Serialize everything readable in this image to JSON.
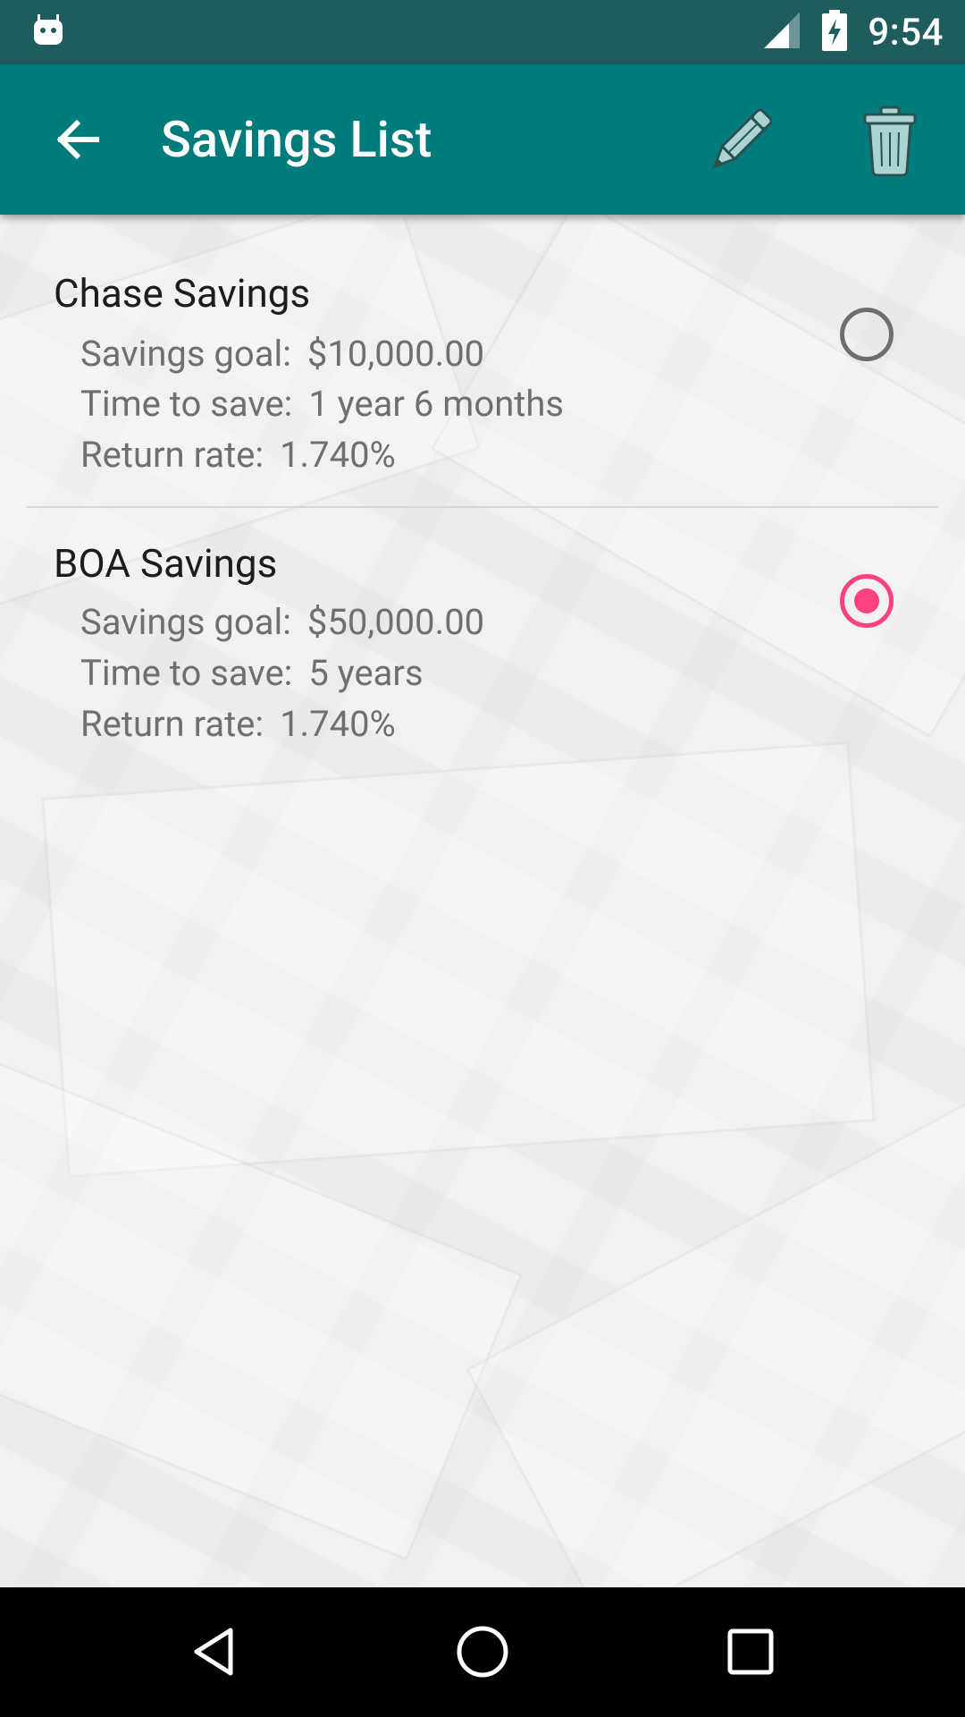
{
  "status_bar": {
    "time": "9:54",
    "icons": [
      "android-debug-icon",
      "signal-icon",
      "battery-charging-icon"
    ]
  },
  "app_bar": {
    "title": "Savings List",
    "actions": [
      "back-arrow-icon",
      "pencil-edit-icon",
      "trash-icon"
    ]
  },
  "savings": [
    {
      "name": "Chase Savings",
      "goal_label": "Savings goal:",
      "goal_value": "$10,000.00",
      "time_label": "Time to save:",
      "time_value": "1 year 6 months",
      "rate_label": "Return rate:",
      "rate_value": "1.740%",
      "selected": false
    },
    {
      "name": "BOA Savings",
      "goal_label": "Savings goal:",
      "goal_value": "$50,000.00",
      "time_label": "Time to save:",
      "time_value": "5 years",
      "rate_label": "Return rate:",
      "rate_value": "1.740%",
      "selected": true
    }
  ],
  "colors": {
    "status_bar": "#1e5c5e",
    "app_bar": "#007c7c",
    "accent": "#ff4081",
    "icon_fill": "#a8d4d2"
  },
  "nav_bar": {
    "buttons": [
      "nav-back-icon",
      "nav-home-icon",
      "nav-recents-icon"
    ]
  }
}
